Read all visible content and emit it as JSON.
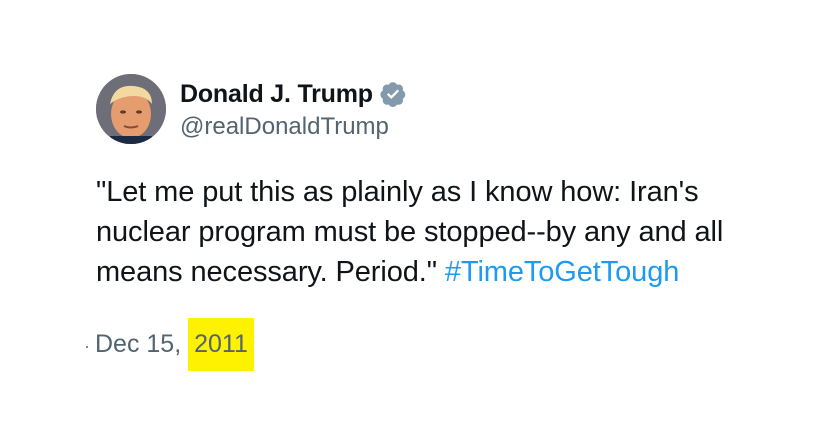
{
  "author": {
    "display_name": "Donald J. Trump",
    "handle": "@realDonaldTrump",
    "verified": true,
    "verified_icon": "verified-badge-icon",
    "avatar": "profile-photo"
  },
  "tweet": {
    "text": "\"Let me put this as plainly as I know how: Iran's nuclear program must be stopped--by any and all means necessary. Period.\" ",
    "hashtag": "#TimeToGetTough",
    "date_prefix": "Dec 15, ",
    "date_year": "2011"
  },
  "colors": {
    "text": "#0f1419",
    "secondary": "#536471",
    "link": "#1d9bf0",
    "verified": "#829aab",
    "highlight": "#fff200"
  }
}
